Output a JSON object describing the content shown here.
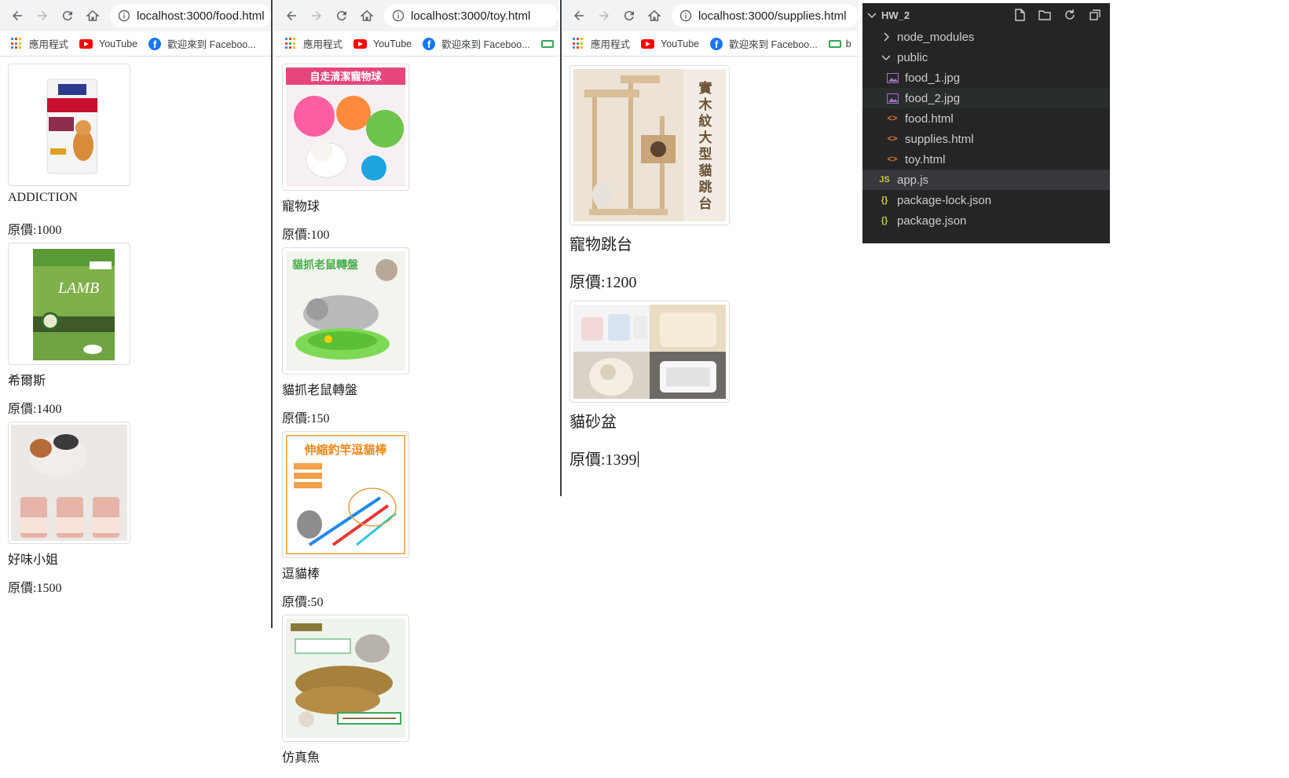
{
  "bookmarks": {
    "apps": "應用程式",
    "youtube": "YouTube",
    "facebook": "歡迎來到 Faceboo...",
    "extra": "b"
  },
  "windows": [
    {
      "url": "localhost:3000/food.html"
    },
    {
      "url": "localhost:3000/toy.html"
    },
    {
      "url": "localhost:3000/supplies.html"
    }
  ],
  "food": {
    "items": [
      {
        "name": "ADDICTION",
        "price": "原價:1000",
        "image": "dog-food-bag"
      },
      {
        "name": "希爾斯",
        "price": "原價:1400",
        "image": "lamb-food-bag"
      },
      {
        "name": "好味小姐",
        "price": "原價:1500",
        "image": "cat-with-jars"
      }
    ]
  },
  "toy": {
    "items": [
      {
        "name": "寵物球",
        "price": "原價:100",
        "image": "pet-balls",
        "image_text": "自走清潔寵物球"
      },
      {
        "name": "貓抓老鼠轉盤",
        "price": "原價:150",
        "image": "mouse-turntable",
        "image_text": "貓抓老鼠轉盤"
      },
      {
        "name": "逗貓棒",
        "price": "原價:50",
        "image": "cat-teaser",
        "image_text": "伸縮釣竿逗貓棒"
      },
      {
        "name": "仿真魚",
        "image": "fish-toy"
      }
    ]
  },
  "supplies": {
    "items": [
      {
        "name": "寵物跳台",
        "price": "原價:1200",
        "image": "cat-tree",
        "image_text": "實木紋大型貓跳台"
      },
      {
        "name": "貓砂盆",
        "price": "原價:1399",
        "image": "litter-box"
      }
    ]
  },
  "explorer": {
    "root": "HW_2",
    "rows": [
      {
        "label": "node_modules",
        "type": "folder-collapsed"
      },
      {
        "label": "public",
        "type": "folder-open"
      },
      {
        "label": "food_1.jpg",
        "type": "image"
      },
      {
        "label": "food_2.jpg",
        "type": "image"
      },
      {
        "label": "food.html",
        "type": "html"
      },
      {
        "label": "supplies.html",
        "type": "html"
      },
      {
        "label": "toy.html",
        "type": "html"
      },
      {
        "label": "app.js",
        "type": "js"
      },
      {
        "label": "package-lock.json",
        "type": "json"
      },
      {
        "label": "package.json",
        "type": "json"
      }
    ]
  },
  "colors": {
    "chrome_toolbar": "#f1f3f4",
    "vscode_sidebar": "#252526",
    "vscode_selected": "#37373d"
  }
}
